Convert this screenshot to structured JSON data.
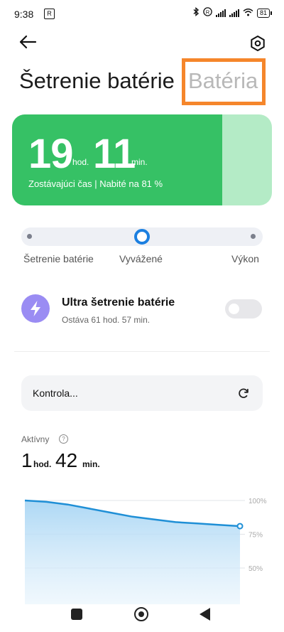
{
  "status_bar": {
    "time": "9:38",
    "recording_icon": "screen-record-icon",
    "battery": "81",
    "icons": [
      "bluetooth-icon",
      "roaming-icon",
      "signal-icon",
      "signal-icon",
      "wifi-icon",
      "battery-icon"
    ]
  },
  "header": {
    "title": "Šetrenie batérie",
    "title_secondary": "Batéria",
    "highlight_color": "#f5862b"
  },
  "battery_card": {
    "hours": "19",
    "hours_unit": "hod.",
    "minutes": "11",
    "minutes_unit": "min.",
    "subtitle": "Zostávajúci čas | Nabité na 81 %",
    "charge_level": 0.81,
    "fill_color": "#36c165",
    "empty_color": "#b4ebc6"
  },
  "modes": {
    "options": [
      "Šetrenie batérie",
      "Vyvážené",
      "Výkon"
    ],
    "selected": "Vyvážené",
    "accent": "#1b7fe0"
  },
  "ultra_saver": {
    "title": "Ultra šetrenie batérie",
    "subtitle": "Ostáva 61 hod. 57 min.",
    "enabled": false,
    "icon": "lightning-icon",
    "icon_color": "#9a8cf3"
  },
  "check": {
    "label": "Kontrola...",
    "icon": "refresh-icon"
  },
  "active": {
    "label": "Aktívny",
    "info_icon": "question-icon",
    "hours": "1",
    "hours_unit": "hod.",
    "minutes": "42",
    "minutes_unit": "min."
  },
  "chart_data": {
    "type": "area",
    "y_tick_labels": [
      "100%",
      "75%",
      "50%"
    ],
    "ylim": [
      50,
      100
    ],
    "values": [
      100,
      99,
      97,
      94,
      91,
      88,
      86,
      84,
      83,
      82,
      81
    ],
    "grid": true,
    "color": "#1f8fd6"
  },
  "nav": {
    "recents_icon": "square-icon",
    "home_icon": "circle-icon",
    "back_icon": "triangle-back-icon"
  }
}
